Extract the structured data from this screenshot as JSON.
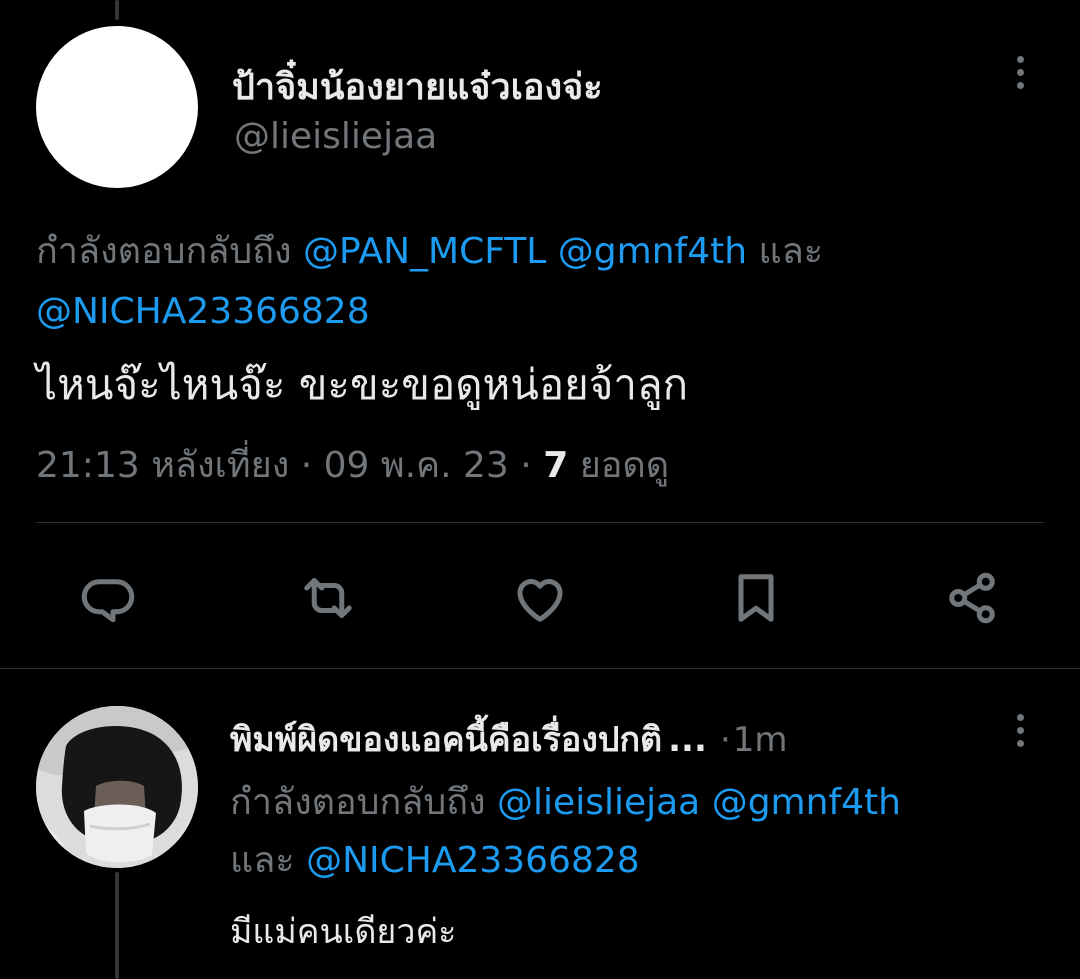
{
  "colors": {
    "background": "#000000",
    "primary_text": "#e7e9ea",
    "secondary_text": "#71767b",
    "link": "#1d9bf0",
    "divider": "#2f3336"
  },
  "main_tweet": {
    "display_name": "ป้าจิ๋มน้องยายแจ๋วเองจ่ะ",
    "handle": "@lieisliejaa",
    "replying_to_prefix": "กำลังตอบกลับถึง",
    "mentions": [
      "@PAN_MCFTL",
      "@gmnf4th",
      "@NICHA23366828"
    ],
    "conjunction": "และ",
    "text": "ไหนจ๊ะไหนจ๊ะ ขะขะขอดูหน่อยจ้าลูก",
    "time": "21:13 หลังเที่ยง",
    "separator": "·",
    "date": "09 พ.ค. 23",
    "views_count": "7",
    "views_label": "ยอดดู"
  },
  "actions": [
    {
      "name": "reply-icon"
    },
    {
      "name": "retweet-icon"
    },
    {
      "name": "like-icon"
    },
    {
      "name": "bookmark-icon"
    },
    {
      "name": "share-icon"
    }
  ],
  "reply_tweet": {
    "display_name": "พิมพ์ผิดของแอคนี้คือเรื่องปกติ",
    "ellipsis": "...",
    "separator": "·",
    "time": "1m",
    "replying_to_prefix": "กำลังตอบกลับถึง",
    "mentions": [
      "@lieisliejaa",
      "@gmnf4th",
      "@NICHA23366828"
    ],
    "conjunction": "และ",
    "text": "มีแม่คนเดียวค่ะ"
  }
}
